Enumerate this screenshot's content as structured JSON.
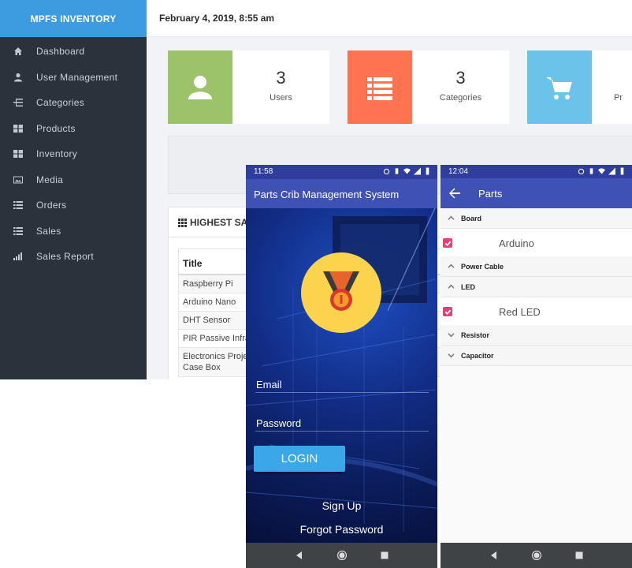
{
  "dashboard": {
    "brand": "MPFS INVENTORY",
    "datetime": "February 4, 2019, 8:55 am",
    "sidebar": {
      "items": [
        {
          "label": "Dashboard",
          "icon": "home-icon"
        },
        {
          "label": "User Management",
          "icon": "user-icon"
        },
        {
          "label": "Categories",
          "icon": "tree-icon"
        },
        {
          "label": "Products",
          "icon": "grid-icon"
        },
        {
          "label": "Inventory",
          "icon": "grid-icon"
        },
        {
          "label": "Media",
          "icon": "image-icon"
        },
        {
          "label": "Orders",
          "icon": "list-icon"
        },
        {
          "label": "Sales",
          "icon": "list-icon"
        },
        {
          "label": "Sales Report",
          "icon": "bar-chart-icon"
        }
      ]
    },
    "stats": [
      {
        "value": "3",
        "label": "Users",
        "color": "#9cc36a",
        "icon": "user-icon"
      },
      {
        "value": "3",
        "label": "Categories",
        "color": "#ff7350",
        "icon": "list-icon"
      },
      {
        "value": "",
        "label": "Pr",
        "color": "#6cc3ea",
        "icon": "cart-icon"
      }
    ],
    "highest_sales": {
      "title": "HIGHEST SA",
      "column_title": "Title",
      "rows": [
        "Raspberry Pi",
        "Arduino Nano",
        "DHT Sensor",
        "PIR Passive Infra",
        "Electronics Projec\nCase Box"
      ]
    }
  },
  "login_app": {
    "status_time": "11:58",
    "app_title": "Parts Crib Management System",
    "email_label": "Email",
    "password_label": "Password",
    "login_button": "LOGIN",
    "sign_up": "Sign Up",
    "forgot_password": "Forgot Password",
    "accent_color": "#3aa7e8"
  },
  "parts_app": {
    "status_time": "12:04",
    "title": "Parts",
    "groups": [
      {
        "name": "Board",
        "expanded": true,
        "children": [
          {
            "label": "Arduino",
            "checked": true
          }
        ]
      },
      {
        "name": "Power Cable",
        "expanded": true,
        "children": []
      },
      {
        "name": "LED",
        "expanded": true,
        "children": [
          {
            "label": "Red LED",
            "checked": true
          }
        ]
      },
      {
        "name": "Resistor",
        "expanded": false,
        "children": []
      },
      {
        "name": "Capacitor",
        "expanded": false,
        "children": []
      }
    ],
    "checkbox_color": "#e0417a"
  }
}
